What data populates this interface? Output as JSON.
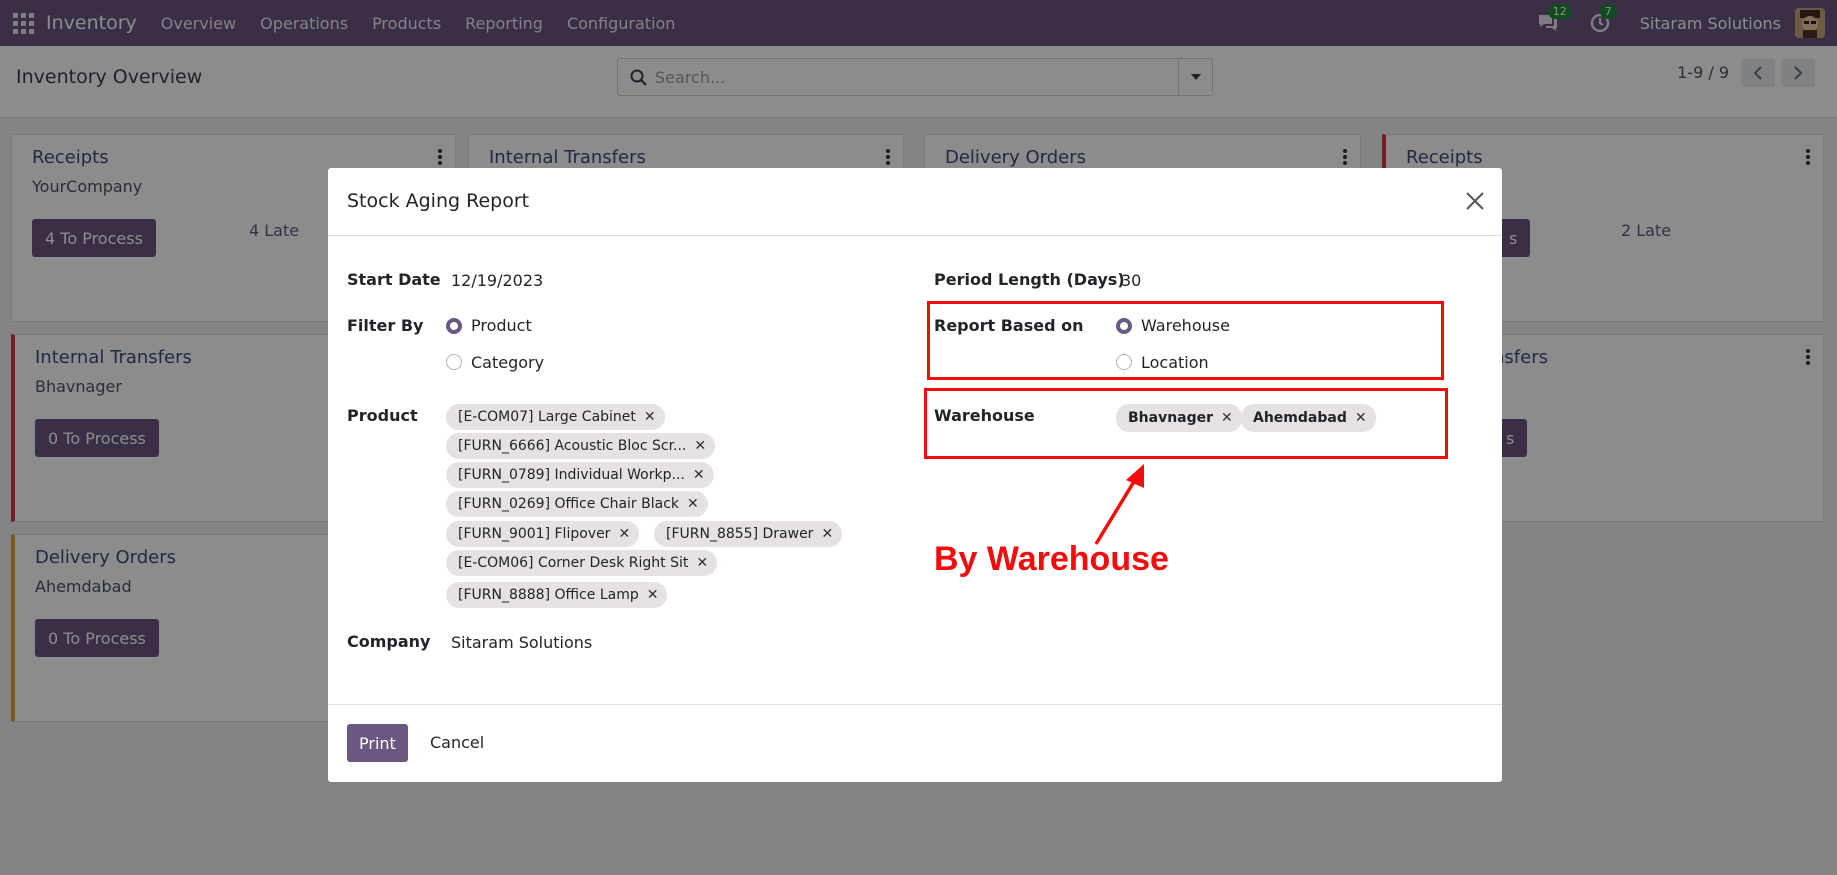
{
  "navbar": {
    "app_name": "Inventory",
    "menu": [
      "Overview",
      "Operations",
      "Products",
      "Reporting",
      "Configuration"
    ],
    "messages_count": "12",
    "activities_count": "7",
    "company": "Sitaram Solutions",
    "brand_color": "#6a5782"
  },
  "control_panel": {
    "title": "Inventory Overview",
    "search_placeholder": "Search...",
    "pager": "1-9 / 9"
  },
  "cards": [
    {
      "title": "Receipts",
      "subtitle": "YourCompany",
      "button": "4 To Process",
      "late": "4 Late"
    },
    {
      "title": "Internal Transfers",
      "subtitle": "",
      "button": "",
      "late": ""
    },
    {
      "title": "Delivery Orders",
      "subtitle": "",
      "button": "",
      "late": ""
    },
    {
      "title": "Receipts",
      "subtitle": "",
      "button": "s",
      "late": "2 Late"
    },
    {
      "title": "Internal Transfers",
      "subtitle": "Bhavnager",
      "button": "0 To Process",
      "late": ""
    },
    {
      "title": "nsfers",
      "subtitle": "",
      "button": "s",
      "late": ""
    },
    {
      "title": "Delivery Orders",
      "subtitle": "Ahemdabad",
      "button": "0 To Process",
      "late": ""
    }
  ],
  "modal": {
    "title": "Stock Aging Report",
    "start_date_label": "Start Date",
    "start_date": "12/19/2023",
    "filter_by_label": "Filter By",
    "filter_options": [
      "Product",
      "Category"
    ],
    "filter_selected": "Product",
    "product_label": "Product",
    "products": [
      "[E-COM07] Large Cabinet",
      "[FURN_6666] Acoustic Bloc Scr...",
      "[FURN_0789] Individual Workp...",
      "[FURN_0269] Office Chair Black",
      "[FURN_9001] Flipover",
      "[FURN_8855] Drawer",
      "[E-COM06] Corner Desk Right Sit",
      "[FURN_8888] Office Lamp"
    ],
    "company_label": "Company",
    "company": "Sitaram Solutions",
    "period_label": "Period Length (Days)",
    "period": "30",
    "report_based_label": "Report Based on",
    "report_options": [
      "Warehouse",
      "Location"
    ],
    "report_selected": "Warehouse",
    "warehouse_label": "Warehouse",
    "warehouses": [
      "Bhavnager",
      "Ahemdabad"
    ],
    "print_label": "Print",
    "cancel_label": "Cancel"
  },
  "annotation": {
    "text": "By Warehouse",
    "color": "#f20d0d"
  }
}
